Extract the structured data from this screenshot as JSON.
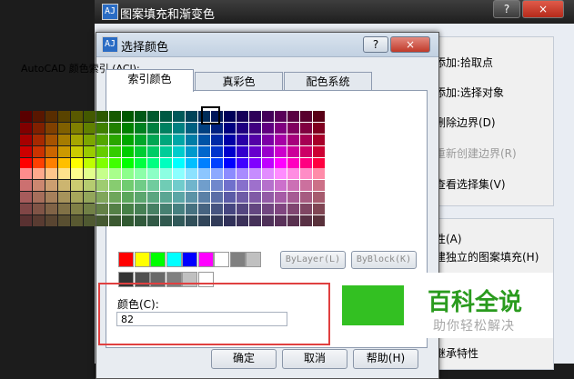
{
  "bg_window": {
    "title": "图案填充和渐变色",
    "help_label": "?",
    "close_label": "×",
    "app_icon_label": "AJ",
    "items": [
      {
        "label": "添加:拾取点",
        "dim": false
      },
      {
        "label": "添加:选择对象",
        "dim": false
      },
      {
        "label": "删除边界(D)",
        "dim": false
      },
      {
        "label": "重新创建边界(R)",
        "dim": true
      },
      {
        "label": "查看选择集(V)",
        "dim": false
      }
    ],
    "items2": [
      {
        "label": "性(A)"
      },
      {
        "label": "建独立的图案填充(H)"
      },
      {
        "label": "继承特性"
      }
    ]
  },
  "dialog": {
    "title": "选择颜色",
    "help_label": "?",
    "close_label": "×",
    "app_icon_label": "AJ",
    "tabs": [
      "索引颜色",
      "真彩色",
      "配色系统"
    ],
    "active_tab": 0,
    "aci_label": "AutoCAD 颜色索引 (ACI):",
    "bylayer_label": "ByLayer(L)",
    "byblock_label": "ByBlock(K)",
    "color_label": "颜色(C):",
    "color_value": "82",
    "current_color": "#0000ff",
    "ok_label": "确定",
    "cancel_label": "取消",
    "help_button_label": "帮助(H)"
  },
  "standard_colors": [
    "#ff0000",
    "#ffff00",
    "#00ff00",
    "#00ffff",
    "#0000ff",
    "#ff00ff",
    "#ffffff",
    "#808080",
    "#c0c0c0"
  ],
  "gray_colors": [
    "#333333",
    "#505050",
    "#696969",
    "#808080",
    "#c0c0c0",
    "#ffffff"
  ],
  "watermark": {
    "title": "百科全说",
    "subtitle": "助你轻松解决"
  }
}
